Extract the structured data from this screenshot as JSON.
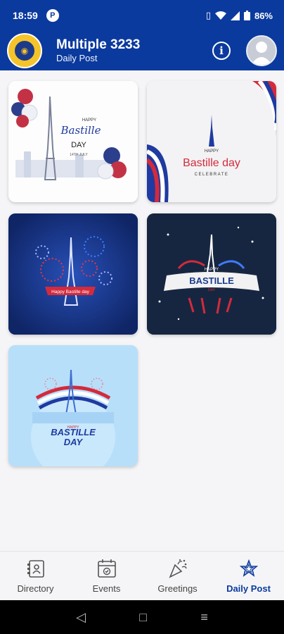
{
  "status_bar": {
    "time": "18:59",
    "app_indicator": "P",
    "battery": "86%",
    "icons": [
      "vibrate-icon",
      "wifi-icon",
      "signal-icon",
      "battery-icon"
    ]
  },
  "header": {
    "title": "Multiple 3233",
    "subtitle": "Daily Post",
    "logo_icon": "lions-club-logo",
    "info_label": "i",
    "avatar_icon": "user-avatar-icon"
  },
  "posts": [
    {
      "text_line1": "HAPPY",
      "text_line2": "Bastille",
      "text_line3": "DAY",
      "text_line4": "14TH JULY"
    },
    {
      "text_line1": "HAPPY",
      "text_line2": "Bastille day",
      "text_line3": "CELEBRATE"
    },
    {
      "text_line1": "Happy Bastille day"
    },
    {
      "text_line1": "HAPPY",
      "text_line2": "BASTILLE",
      "text_line3": "DAY"
    },
    {
      "text_line1": "HAPPY",
      "text_line2": "BASTILLE",
      "text_line3": "DAY"
    }
  ],
  "bottom_nav": [
    {
      "label": "Directory",
      "icon": "directory-icon",
      "active": false
    },
    {
      "label": "Events",
      "icon": "calendar-check-icon",
      "active": false
    },
    {
      "label": "Greetings",
      "icon": "party-popper-icon",
      "active": false
    },
    {
      "label": "Daily Post",
      "icon": "star-icon",
      "active": true
    }
  ],
  "system_nav": {
    "back": "◁",
    "home": "□",
    "recents": "≡"
  },
  "colors": {
    "primary": "#0b3a9e",
    "french_blue": "#1f3aa0",
    "french_red": "#d42a3c"
  }
}
